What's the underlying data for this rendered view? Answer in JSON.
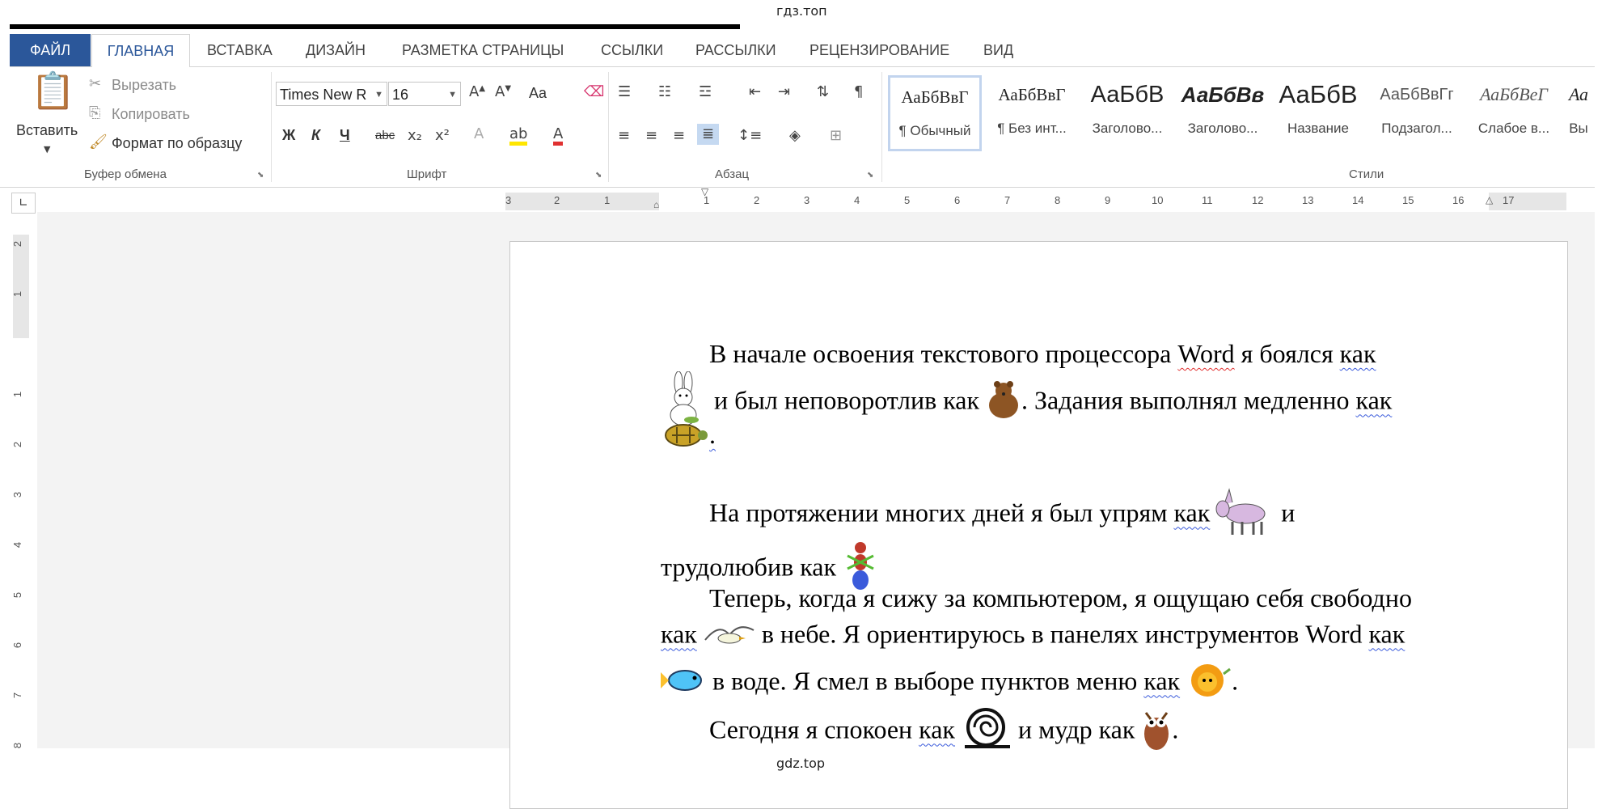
{
  "watermark_top": "гдз.топ",
  "watermark_bottom": "gdz.top",
  "tabs": {
    "file": "ФАЙЛ",
    "home": "ГЛАВНАЯ",
    "insert": "ВСТАВКА",
    "design": "ДИЗАЙН",
    "layout": "РАЗМЕТКА СТРАНИЦЫ",
    "refs": "ССЫЛКИ",
    "mail": "РАССЫЛКИ",
    "review": "РЕЦЕНЗИРОВАНИЕ",
    "view": "ВИД"
  },
  "clipboard": {
    "paste": "Вставить",
    "cut": "Вырезать",
    "copy": "Копировать",
    "format_painter": "Формат по образцу",
    "group": "Буфер обмена"
  },
  "font": {
    "name": "Times New R",
    "size": "16",
    "case": "Aa",
    "bold": "Ж",
    "italic": "К",
    "underline": "Ч",
    "strike": "abc",
    "group": "Шрифт"
  },
  "paragraph": {
    "group": "Абзац"
  },
  "styles": {
    "group": "Стили",
    "items": [
      {
        "preview": "АаБбВвГ",
        "name": "¶ Обычный"
      },
      {
        "preview": "АаБбВвГ",
        "name": "¶ Без инт..."
      },
      {
        "preview": "АаБбВ",
        "name": "Заголово..."
      },
      {
        "preview": "АаБбВв",
        "name": "Заголово..."
      },
      {
        "preview": "АаБбВ",
        "name": "Название"
      },
      {
        "preview": "АаБбВвГг",
        "name": "Подзагол..."
      },
      {
        "preview": "АаБбВеГ",
        "name": "Слабое в..."
      },
      {
        "preview": "Аа",
        "name": "Вы"
      }
    ]
  },
  "ruler_h": [
    "3",
    "2",
    "1",
    "1",
    "2",
    "3",
    "4",
    "5",
    "6",
    "7",
    "8",
    "9",
    "10",
    "11",
    "12",
    "13",
    "14",
    "15",
    "16",
    "17"
  ],
  "ruler_v": [
    "2",
    "1",
    "1",
    "2",
    "3",
    "4",
    "5",
    "6",
    "7",
    "8"
  ],
  "corner": "∟",
  "doc": {
    "p1a": "В  начале  освоения  текстового  процессора ",
    "word1": "Word",
    "p1b": " я  боялся ",
    "kak": "как",
    "p1c": " и  был  неповоротлив  как ",
    "p1d": ".  Задания  выполнял  медленно ",
    "dot": ".",
    "p2a": "На   протяжении   многих   дней   я   был   упрям ",
    "p2b": " и",
    "p2c": "трудолюбив как ",
    "p3a": "Теперь, когда я сижу за компьютером, я ощущаю себя свободно",
    "p3b": " в небе. Я ориентируюсь в панелях инструментов Word ",
    "p3c": " в воде. Я смел в выборе пунктов меню ",
    "p4a": "Сегодня я спокоен ",
    "p4b": " и мудр как ",
    "colors": {
      "accent": "#2b579a",
      "squiggle_blue": "#3b5bdb",
      "squiggle_red": "#e03131"
    }
  }
}
